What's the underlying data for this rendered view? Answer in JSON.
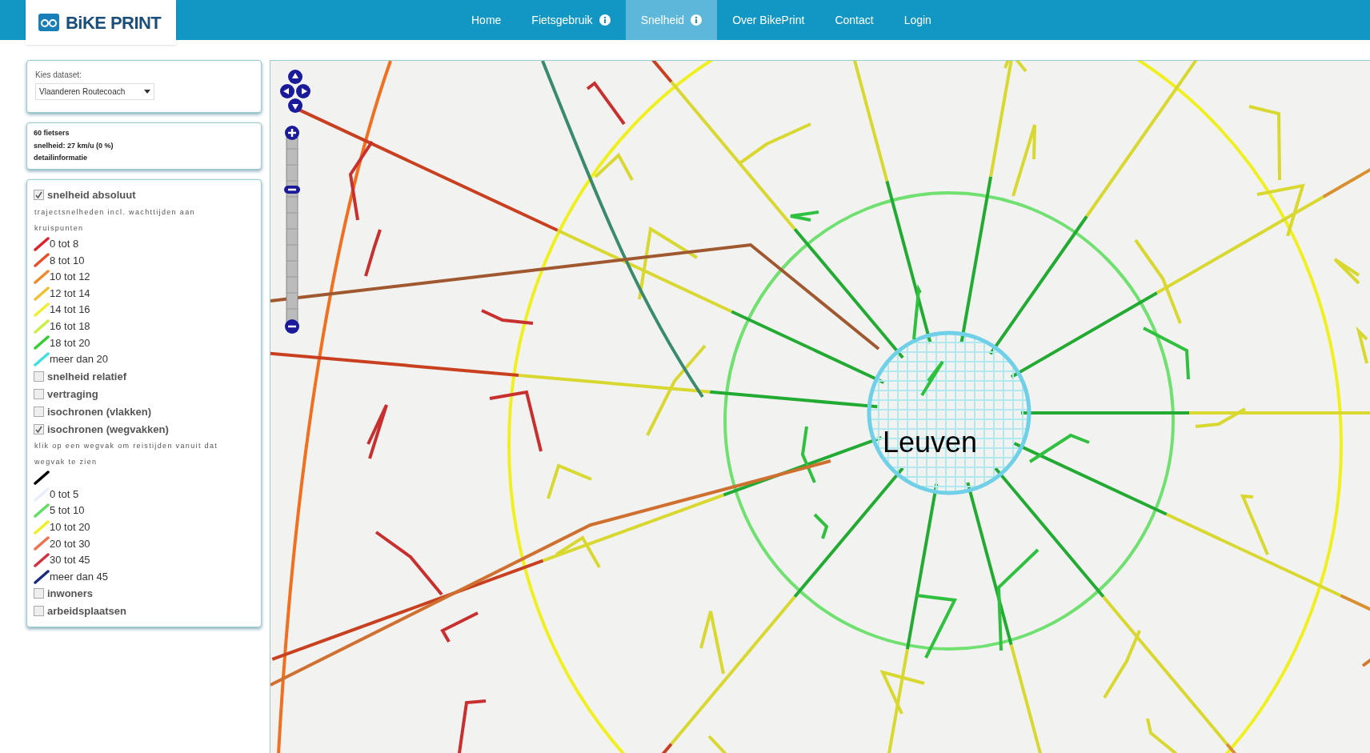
{
  "header": {
    "logo": "BiKE PRINT",
    "nav": [
      {
        "label": "Home",
        "info": false,
        "selected": false
      },
      {
        "label": "Fietsgebruik",
        "info": true,
        "selected": false
      },
      {
        "label": "Snelheid",
        "info": true,
        "selected": true
      },
      {
        "label": "Over BikePrint",
        "info": false,
        "selected": false
      },
      {
        "label": "Contact",
        "info": false,
        "selected": false
      },
      {
        "label": "Login",
        "info": false,
        "selected": false
      }
    ]
  },
  "sidebar": {
    "dataset": {
      "label": "Kies dataset:",
      "value": "Vlaanderen Routecoach"
    },
    "summary": [
      "60 fietsers",
      "snelheid: 27 km/u (0 %)",
      "detailinformatie"
    ],
    "layers": [
      {
        "kind": "checkbox",
        "label": "snelheid absoluut",
        "checked": true
      },
      {
        "kind": "note",
        "text": "trajectsnelheden incl. wachttijden aan kruispunten"
      },
      {
        "kind": "legend",
        "label": "0 tot 8",
        "color": "#e0202a"
      },
      {
        "kind": "legend",
        "label": "8 tot 10",
        "color": "#e8502a"
      },
      {
        "kind": "legend",
        "label": "10 tot 12",
        "color": "#f08a2a"
      },
      {
        "kind": "legend",
        "label": "12 tot 14",
        "color": "#f0c030"
      },
      {
        "kind": "legend",
        "label": "14 tot 16",
        "color": "#f0f030"
      },
      {
        "kind": "legend",
        "label": "16 tot 18",
        "color": "#c8f040"
      },
      {
        "kind": "legend",
        "label": "18 tot 20",
        "color": "#30d030"
      },
      {
        "kind": "legend",
        "label": "meer dan 20",
        "color": "#40e0e0"
      },
      {
        "kind": "checkbox",
        "label": "snelheid relatief",
        "checked": false
      },
      {
        "kind": "checkbox",
        "label": "vertraging",
        "checked": false
      },
      {
        "kind": "checkbox",
        "label": "isochronen (vlakken)",
        "checked": false
      },
      {
        "kind": "checkbox",
        "label": "isochronen (wegvakken)",
        "checked": true
      },
      {
        "kind": "note",
        "text": "klik op een wegvak om reistijden vanuit dat wegvak te zien"
      },
      {
        "kind": "swatch",
        "color": "#000000"
      },
      {
        "kind": "legend",
        "label": "0 tot 5",
        "color": "#e8eefc"
      },
      {
        "kind": "legend",
        "label": "5 tot 10",
        "color": "#60e060"
      },
      {
        "kind": "legend",
        "label": "10 tot 20",
        "color": "#f0f020"
      },
      {
        "kind": "legend",
        "label": "20 tot 30",
        "color": "#f07050"
      },
      {
        "kind": "legend",
        "label": "30 tot 45",
        "color": "#d03040"
      },
      {
        "kind": "legend",
        "label": "meer dan 45",
        "color": "#1a2a80"
      },
      {
        "kind": "checkbox",
        "label": "inwoners",
        "checked": false
      },
      {
        "kind": "checkbox",
        "label": "arbeidsplaatsen",
        "checked": false
      }
    ]
  },
  "map": {
    "place_label": "Leuven"
  }
}
